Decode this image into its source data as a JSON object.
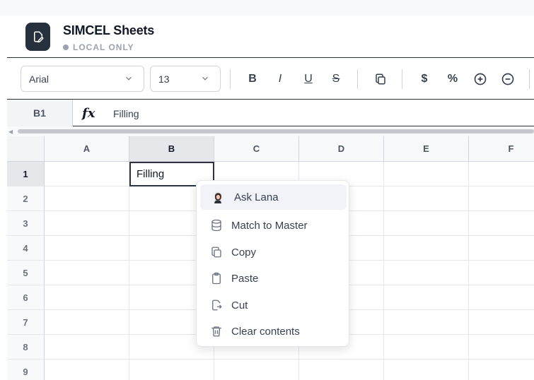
{
  "app": {
    "title": "SIMCEL Sheets",
    "status": "LOCAL ONLY"
  },
  "toolbar": {
    "font": "Arial",
    "size": "13",
    "bold_label": "B",
    "italic_label": "I",
    "underline_label": "U",
    "strike_label": "S",
    "currency_label": "$",
    "percent_label": "%"
  },
  "formula_bar": {
    "cell_ref": "B1",
    "fx_label": "fx",
    "value": "Filling"
  },
  "grid": {
    "columns": [
      "A",
      "B",
      "C",
      "D",
      "E",
      "F"
    ],
    "rows": [
      "1",
      "2",
      "3",
      "4",
      "5",
      "6",
      "7",
      "8",
      "9"
    ],
    "cells": {
      "B1": "Filling"
    },
    "selected_cell": "B1"
  },
  "context_menu": {
    "items": [
      {
        "label": "Ask Lana",
        "icon": "avatar-icon"
      },
      {
        "label": "Match to Master",
        "icon": "database-icon"
      },
      {
        "label": "Copy",
        "icon": "copy-icon"
      },
      {
        "label": "Paste",
        "icon": "clipboard-icon"
      },
      {
        "label": "Cut",
        "icon": "cut-icon"
      },
      {
        "label": "Clear contents",
        "icon": "trash-icon"
      }
    ]
  }
}
